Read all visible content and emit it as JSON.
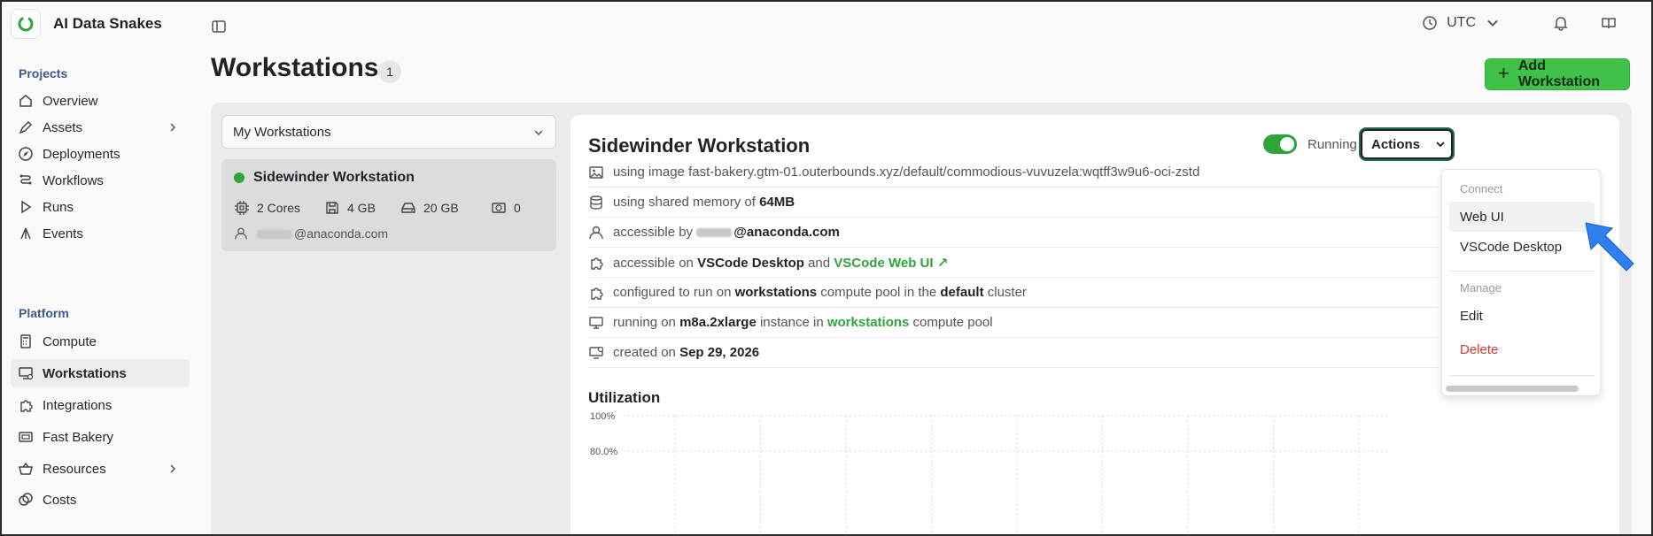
{
  "brand": {
    "name": "AI Data Snakes"
  },
  "sidebar": {
    "projects_label": "Projects",
    "platform_label": "Platform",
    "projects": [
      {
        "label": "Overview",
        "icon": "home-icon"
      },
      {
        "label": "Assets",
        "icon": "pen-icon",
        "expandable": true
      },
      {
        "label": "Deployments",
        "icon": "compass-icon"
      },
      {
        "label": "Workflows",
        "icon": "workflow-icon"
      },
      {
        "label": "Runs",
        "icon": "play-icon"
      },
      {
        "label": "Events",
        "icon": "event-icon"
      }
    ],
    "platform": [
      {
        "label": "Compute",
        "icon": "calculator-icon"
      },
      {
        "label": "Workstations",
        "icon": "workstation-icon",
        "active": true
      },
      {
        "label": "Integrations",
        "icon": "puzzle-icon"
      },
      {
        "label": "Fast Bakery",
        "icon": "bakery-icon"
      },
      {
        "label": "Resources",
        "icon": "basket-icon",
        "expandable": true
      },
      {
        "label": "Costs",
        "icon": "coins-icon"
      }
    ]
  },
  "topbar": {
    "timezone": "UTC"
  },
  "page": {
    "title": "Workstations",
    "count": "1",
    "add_button": "Add Workstation"
  },
  "list": {
    "filter": "My Workstations",
    "card": {
      "name": "Sidewinder Workstation",
      "cores": "2 Cores",
      "memory": "4 GB",
      "disk": "20 GB",
      "gpu": "0",
      "owner_domain": "@anaconda.com"
    }
  },
  "detail": {
    "title": "Sidewinder Workstation",
    "status": "Running",
    "actions_label": "Actions",
    "rows": {
      "image_prefix": "using image ",
      "image": "fast-bakery.gtm-01.outerbounds.xyz/default/commodious-vuvuzela:wqtff3w9u6-oci-zstd",
      "memory_prefix": "using shared memory of ",
      "memory": "64MB",
      "access_prefix": "accessible by ",
      "access_domain": "@anaconda.com",
      "on_prefix": "accessible on ",
      "on_desktop": "VSCode Desktop",
      "on_and": " and ",
      "on_web": "VSCode Web UI",
      "pool_prefix": "configured to run on ",
      "pool_name": "workstations",
      "pool_mid": " compute pool in the ",
      "pool_cluster": "default",
      "pool_suffix": " cluster",
      "inst_prefix": "running on ",
      "inst_type": "m8a.2xlarge",
      "inst_mid": " instance in ",
      "inst_pool": "workstations",
      "inst_suffix": " compute pool",
      "created_prefix": "created on ",
      "created_date": "Sep 29, 2026"
    },
    "utilization": {
      "title": "Utilization",
      "ticks": [
        "100%",
        "80.0%"
      ]
    }
  },
  "menu": {
    "connect_label": "Connect",
    "web_ui": "Web UI",
    "vscode_desktop": "VSCode Desktop",
    "manage_label": "Manage",
    "edit": "Edit",
    "delete": "Delete"
  },
  "colors": {
    "accent": "#3fc14a",
    "danger": "#d43b2f",
    "link": "#2ea43a",
    "pointer": "#2f7ff0"
  }
}
